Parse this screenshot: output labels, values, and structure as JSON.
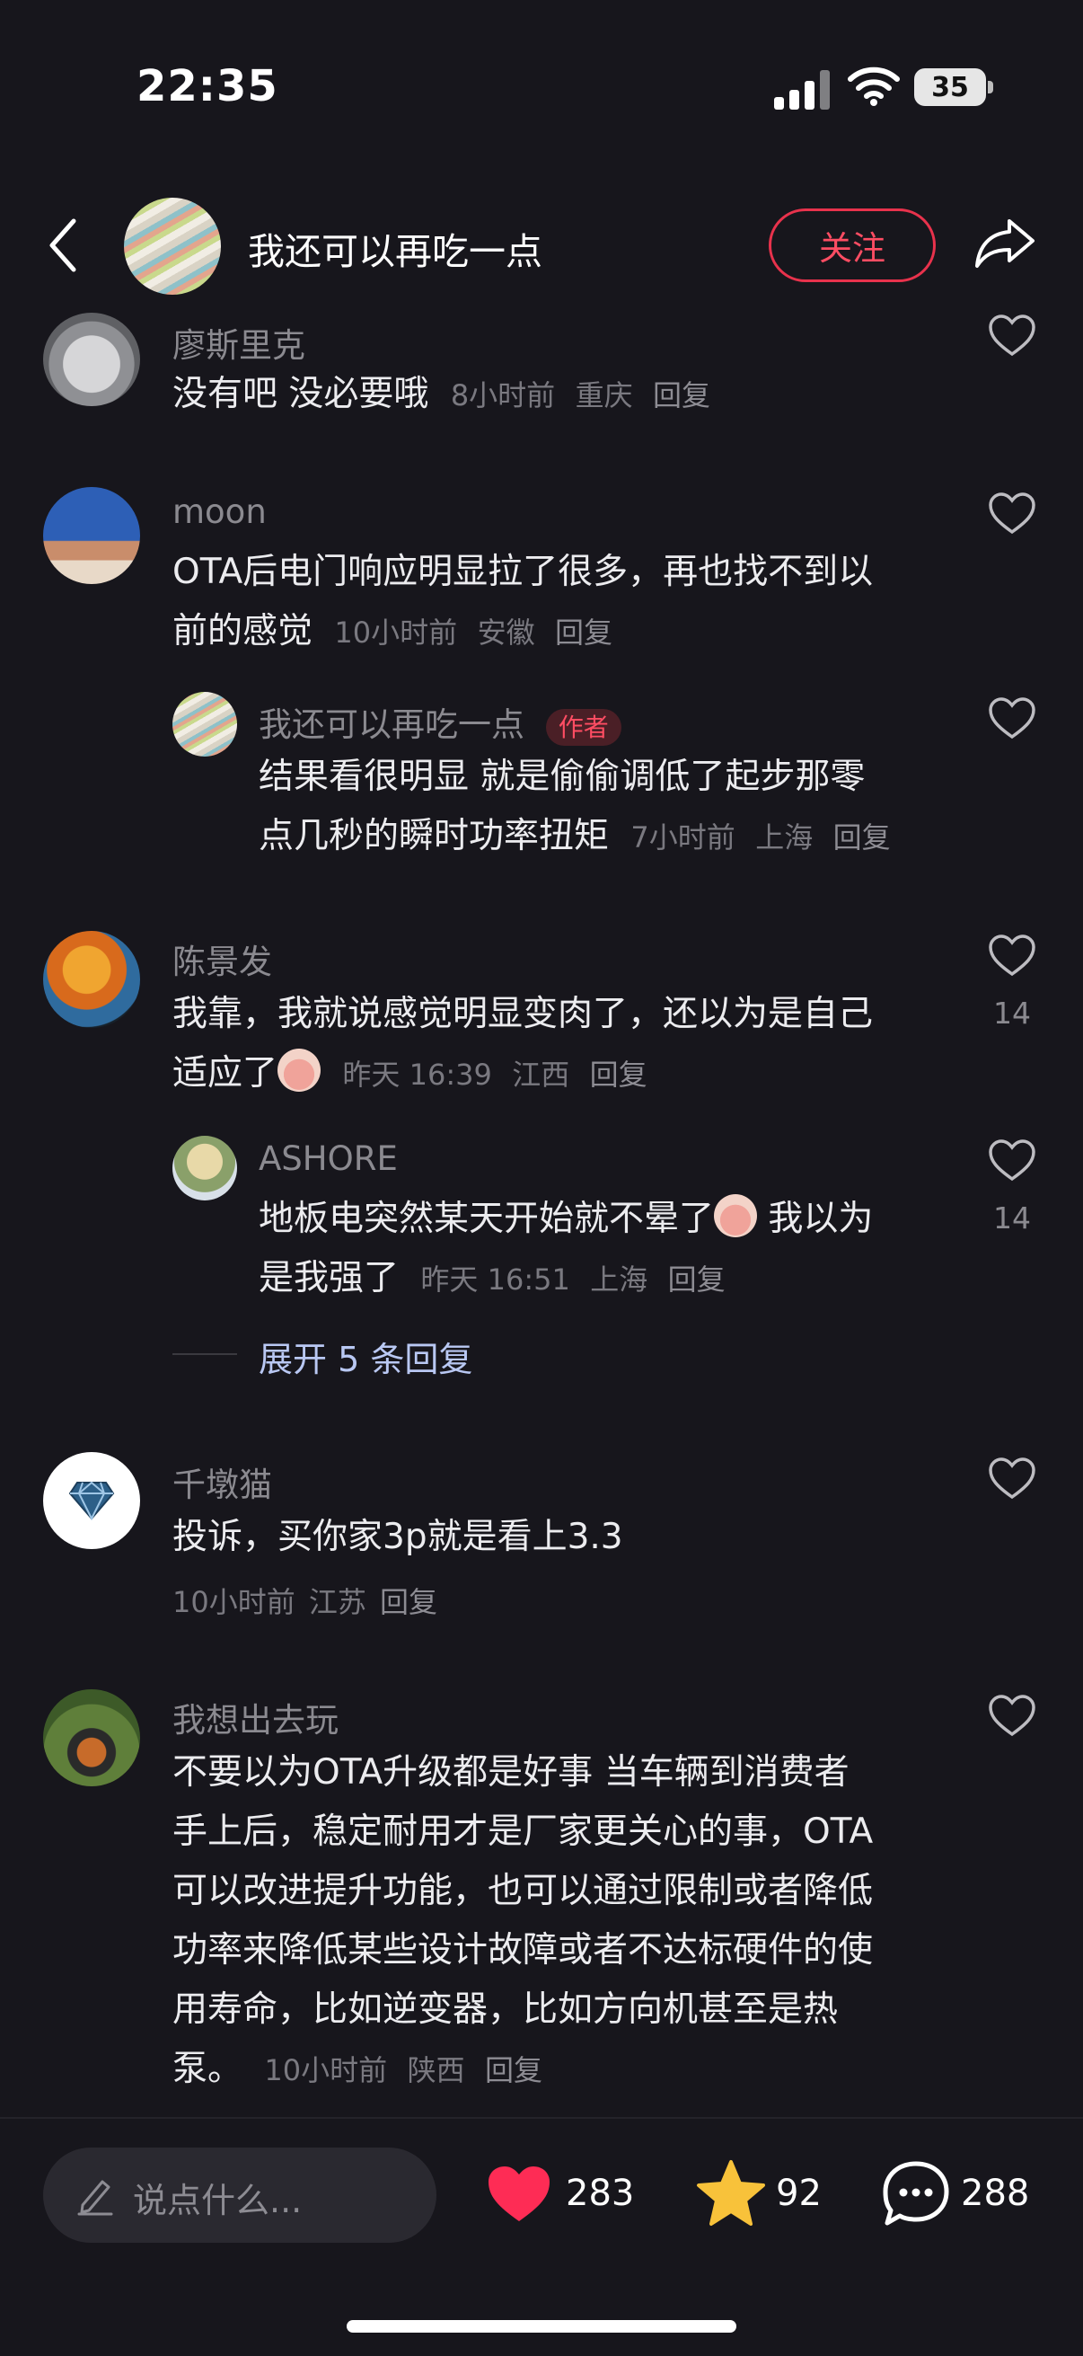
{
  "status_bar": {
    "time": "22:35",
    "battery": "35"
  },
  "header": {
    "title": "我还可以再吃一点",
    "follow_label": "关注"
  },
  "comments": [
    {
      "name": "廖斯里克",
      "text": "没有吧 没必要哦",
      "time": "8小时前",
      "location": "重庆",
      "reply": "回复"
    },
    {
      "name": "moon",
      "text_line1": "OTA后电门响应明显拉了很多，再也找不到以",
      "text_line2": "前的感觉",
      "time": "10小时前",
      "location": "安徽",
      "reply": "回复",
      "sub": {
        "name": "我还可以再吃一点",
        "tag": "作者",
        "text_line1": "结果看很明显 就是偷偷调低了起步那零",
        "text_line2": "点几秒的瞬时功率扭矩",
        "time": "7小时前",
        "location": "上海",
        "reply": "回复"
      }
    },
    {
      "name": "陈景发",
      "text_line1": "我靠，我就说感觉明显变肉了，还以为是自己",
      "text_line2": "适应了",
      "time": "昨天 16:39",
      "location": "江西",
      "reply": "回复",
      "likes": "14",
      "sub": {
        "name": "ASHORE",
        "text_line1": "地板电突然某天开始就不晕了",
        "text_line1b": "我以为",
        "text_line2": "是我强了",
        "time": "昨天 16:51",
        "location": "上海",
        "reply": "回复",
        "likes": "14"
      },
      "expand": "展开 5 条回复"
    },
    {
      "name": "千墩猫",
      "text": "投诉，买你家3p就是看上3.3",
      "time": "10小时前",
      "location": "江苏",
      "reply": "回复"
    },
    {
      "name": "我想出去玩",
      "lines": [
        "不要以为OTA升级都是好事 当车辆到消费者",
        "手上后，稳定耐用才是厂家更关心的事，OTA",
        "可以改进提升功能，也可以通过限制或者降低",
        "功率来降低某些设计故障或者不达标硬件的使",
        "用寿命，比如逆变器，比如方向机甚至是热"
      ],
      "last_line": "泵。",
      "time": "10小时前",
      "location": "陕西",
      "reply": "回复"
    }
  ],
  "bottom_bar": {
    "placeholder": "说点什么...",
    "likes": "283",
    "stars": "92",
    "comments": "288"
  },
  "colors": {
    "background": "#17161c",
    "accent": "#ff4d63",
    "star": "#f8c23a"
  },
  "icons": [
    "back-icon",
    "share-icon",
    "heart-icon",
    "pencil-icon",
    "star-icon",
    "comment-icon",
    "wifi-icon",
    "signal-icon",
    "diamond-icon"
  ]
}
